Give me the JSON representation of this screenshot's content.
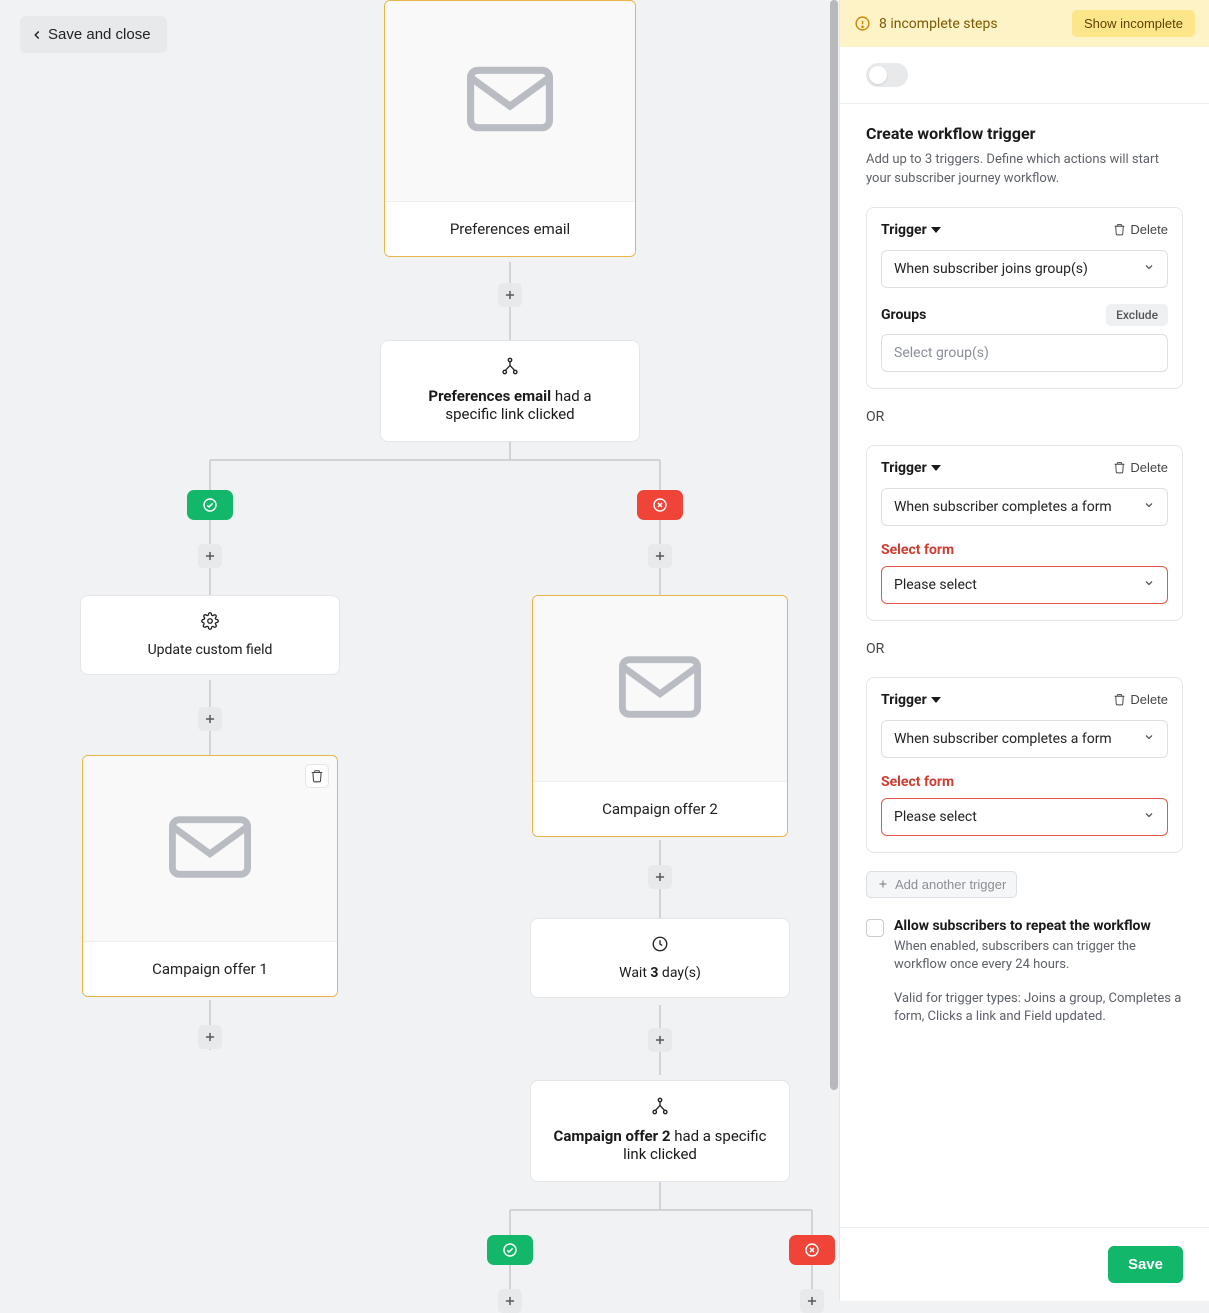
{
  "header": {
    "save_close_label": "Save and close"
  },
  "canvas": {
    "email1": {
      "title": "Preferences email"
    },
    "branch1": {
      "bold": "Preferences email",
      "rest": " had a specific link clicked"
    },
    "action1": {
      "label": "Update custom field"
    },
    "email2": {
      "title": "Campaign offer 1"
    },
    "email3": {
      "title": "Campaign offer 2"
    },
    "wait1": {
      "prefix": "Wait ",
      "num": "3",
      "suffix": " day(s)"
    },
    "branch2": {
      "bold": "Campaign offer 2",
      "rest": " had a specific link clicked"
    }
  },
  "panel": {
    "banner_text": "8 incomplete steps",
    "banner_button": "Show incomplete",
    "title": "Create workflow trigger",
    "subtitle": "Add up to 3 triggers. Define which actions will start your subscriber journey workflow.",
    "trigger_label": "Trigger",
    "delete_label": "Delete",
    "or_label": "OR",
    "groups_label": "Groups",
    "exclude_label": "Exclude",
    "select_form_label": "Select form",
    "t1_value": "When subscriber joins group(s)",
    "groups_placeholder": "Select group(s)",
    "t2_value": "When subscriber completes a form",
    "form_placeholder": "Please select",
    "t3_value": "When subscriber completes a form",
    "add_trigger_label": "Add another trigger",
    "repeat_title": "Allow subscribers to repeat the workflow",
    "repeat_sub": "When enabled, subscribers can trigger the workflow once every 24 hours.",
    "repeat_valid": "Valid for trigger types: Joins a group, Completes a form, Clicks a link and Field updated.",
    "save_label": "Save"
  }
}
